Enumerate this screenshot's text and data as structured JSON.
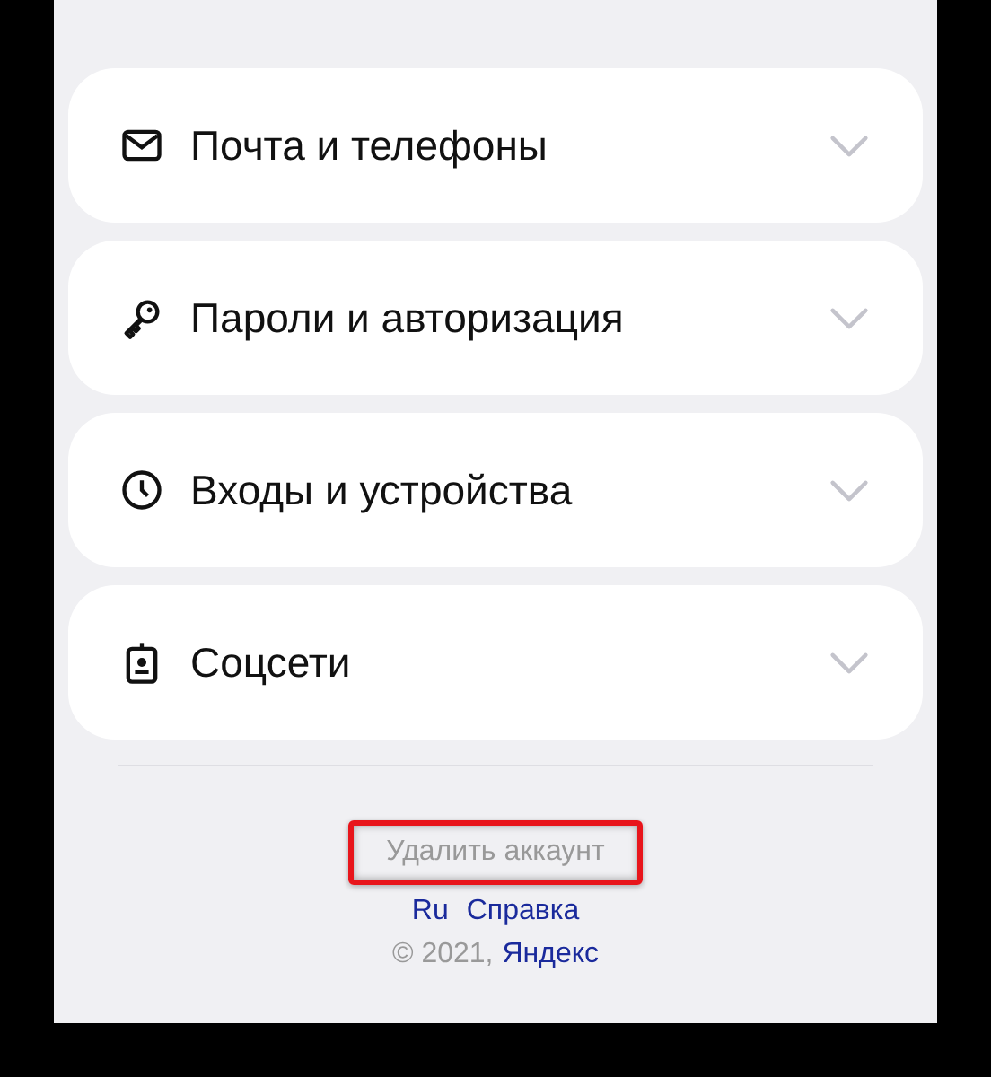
{
  "sections": [
    {
      "kind": "mail",
      "label": "Почта и телефоны",
      "expanded": false
    },
    {
      "kind": "key",
      "label": "Пароли и авторизация",
      "expanded": false
    },
    {
      "kind": "clock",
      "label": "Входы и устройства",
      "expanded": false
    },
    {
      "kind": "badge",
      "label": "Соцсети",
      "expanded": false
    }
  ],
  "delete_account": {
    "label": "Удалить аккаунт",
    "highlighted": true
  },
  "footer_links": [
    "Ru",
    "Справка"
  ],
  "copyright": {
    "text": "© 2021,",
    "link": "Яндекс"
  }
}
